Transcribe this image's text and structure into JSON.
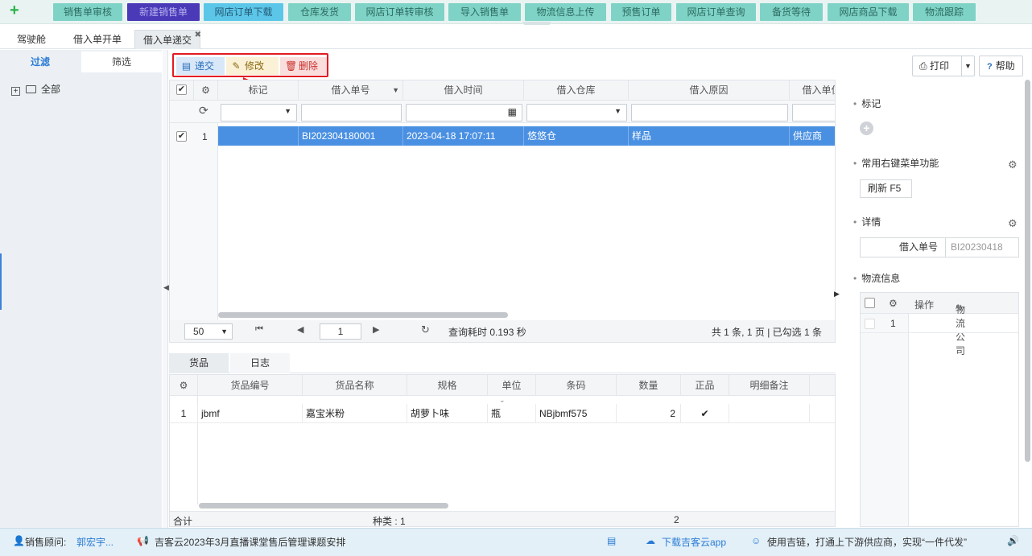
{
  "topnav": {
    "items": [
      "销售单审核",
      "新建销售单",
      "网店订单下载",
      "仓库发货",
      "网店订单转审核",
      "导入销售单",
      "物流信息上传",
      "预售订单",
      "网店订单查询",
      "备货等待",
      "网店商品下载",
      "物流跟踪"
    ]
  },
  "tabs": [
    "驾驶舱",
    "借入单开单",
    "借入单递交"
  ],
  "left": {
    "tab_filter": "过滤",
    "tab_select": "筛选",
    "tree_root": "全部"
  },
  "toolbar": {
    "submit": "递交",
    "edit": "修改",
    "delete": "删除",
    "print": "打印",
    "help": "帮助"
  },
  "grid": {
    "columns": [
      "标记",
      "借入单号",
      "借入时间",
      "借入仓库",
      "借入原因",
      "借入单位"
    ],
    "rows": [
      {
        "num": "1",
        "no": "BI202304180001",
        "time": "2023-04-18 17:07:11",
        "warehouse": "悠悠仓",
        "reason": "样品",
        "unit": "供应商"
      }
    ]
  },
  "pager": {
    "page_size": "50",
    "page": "1",
    "time": "查询耗时 0.193 秒",
    "summary": "共 1 条, 1 页 | 已勾选 1 条"
  },
  "detail_tabs": [
    "货品",
    "日志"
  ],
  "detail": {
    "columns": [
      "货品编号",
      "货品名称",
      "规格",
      "单位",
      "条码",
      "数量",
      "正品",
      "明细备注"
    ],
    "rows": [
      {
        "num": "1",
        "code": "jbmf",
        "name": "嘉宝米粉",
        "spec": "胡萝卜味",
        "unit": "瓶",
        "barcode": "NBjbmf575",
        "qty": "2",
        "genuine": "✔",
        "remark": ""
      }
    ],
    "footer_total": "合计",
    "footer_kinds": "种类 : 1",
    "footer_qty": "2"
  },
  "right": {
    "mark": "标记",
    "common_menu": "常用右键菜单功能",
    "refresh": "刷新  F5",
    "details": "详情",
    "detail_key": "借入单号",
    "detail_value": "BI20230418",
    "logistics": "物流信息",
    "logi_op": "操作",
    "logi_company": "物流公司",
    "logi_row": "1"
  },
  "status": {
    "advisor_label": "销售顾问:",
    "advisor_name": "郭宏宇...",
    "notice": "吉客云2023年3月直播课堂售后管理课题安排",
    "download": "下载吉客云app",
    "slogan": "使用吉链，打通上下游供应商，实现“一件代发”"
  },
  "colors": {
    "accent": "#4a90e2",
    "nav_bg": "#7fd3c6",
    "highlight_box": "#e31b23"
  }
}
